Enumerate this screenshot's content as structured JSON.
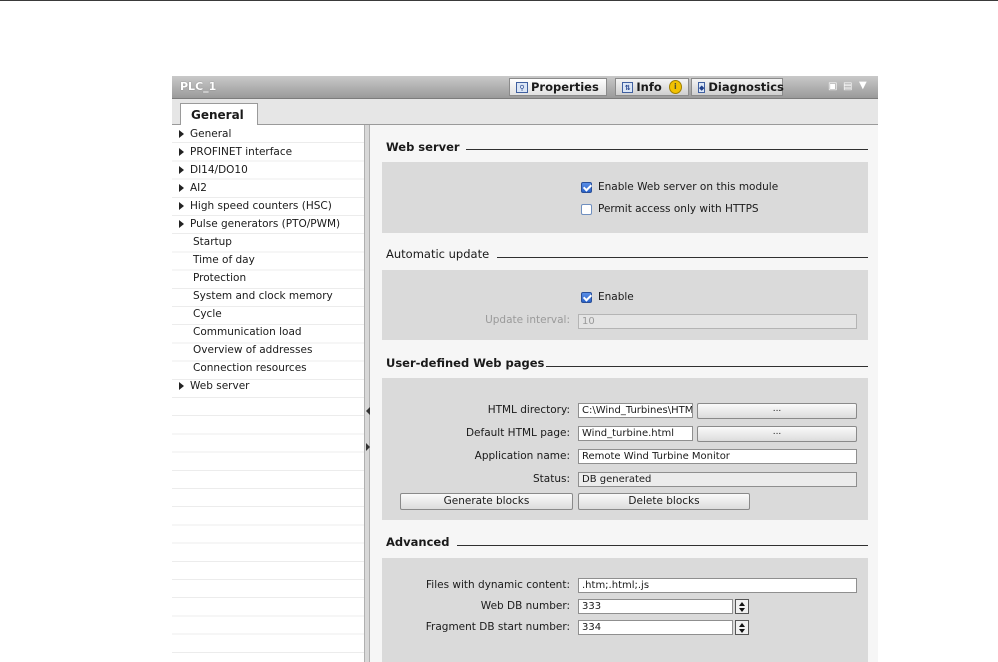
{
  "window": {
    "title": "PLC_1"
  },
  "header_tabs": [
    {
      "label": "Properties",
      "icon": "properties-icon"
    },
    {
      "label": "Info",
      "icon": "info-icon"
    },
    {
      "label": "Diagnostics",
      "icon": "diagnostics-icon"
    }
  ],
  "general_tab": {
    "label": "General"
  },
  "nav": {
    "items": [
      {
        "label": "General",
        "expandable": true
      },
      {
        "label": "PROFINET interface",
        "expandable": true
      },
      {
        "label": "DI14/DO10",
        "expandable": true
      },
      {
        "label": "AI2",
        "expandable": true
      },
      {
        "label": "High speed counters (HSC)",
        "expandable": true
      },
      {
        "label": "Pulse generators (PTO/PWM)",
        "expandable": true
      },
      {
        "label": "Startup",
        "expandable": false
      },
      {
        "label": "Time of day",
        "expandable": false
      },
      {
        "label": "Protection",
        "expandable": false
      },
      {
        "label": "System and clock memory",
        "expandable": false
      },
      {
        "label": "Cycle",
        "expandable": false
      },
      {
        "label": "Communication load",
        "expandable": false
      },
      {
        "label": "Overview of addresses",
        "expandable": false
      },
      {
        "label": "Connection resources",
        "expandable": false
      },
      {
        "label": "Web server",
        "expandable": true,
        "selected": true
      }
    ]
  },
  "web_server": {
    "heading": "Web server",
    "enable_label": "Enable Web server on this module",
    "enable_checked": true,
    "https_label": "Permit access only with HTTPS",
    "https_checked": false
  },
  "automatic_update": {
    "heading": "Automatic update",
    "enable_label": "Enable",
    "enable_checked": true,
    "interval_label": "Update interval:",
    "interval_value": "10"
  },
  "user_pages": {
    "heading": "User-defined Web pages",
    "html_dir_label": "HTML directory:",
    "html_dir_value": "C:\\Wind_Turbines\\HTM",
    "browse_label": "...",
    "default_page_label": "Default HTML page:",
    "default_page_value": "Wind_turbine.html",
    "app_name_label": "Application name:",
    "app_name_value": "Remote Wind Turbine Monitor",
    "status_label": "Status:",
    "status_value": "DB generated",
    "generate_label": "Generate blocks",
    "delete_label": "Delete blocks"
  },
  "advanced": {
    "heading": "Advanced",
    "dynamic_label": "Files with dynamic content:",
    "dynamic_value": ".htm;.html;.js",
    "db_number_label": "Web DB number:",
    "db_number_value": "333",
    "fragment_label": "Fragment DB start number:",
    "fragment_value": "334"
  },
  "colors": {
    "panel": "#dadada",
    "content_bg": "#f6f6f6",
    "checkbox_blue": "#2b63c8"
  }
}
